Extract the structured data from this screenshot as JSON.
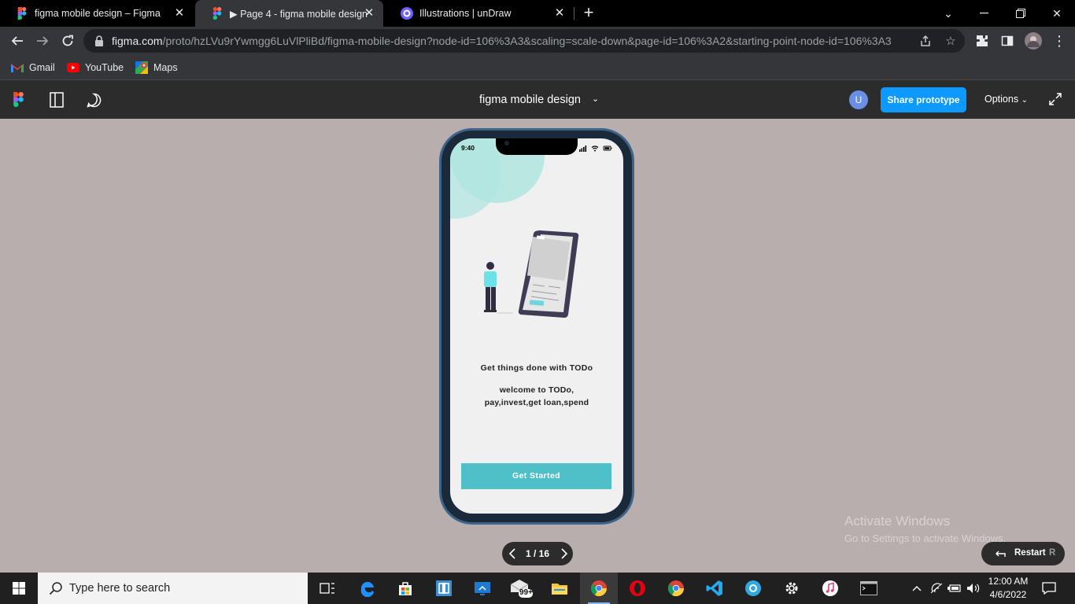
{
  "browser": {
    "tabs": [
      {
        "title": "figma mobile design – Figma",
        "icon": "figma-icon"
      },
      {
        "title": "▶ Page 4 - figma mobile design",
        "icon": "figma-icon"
      },
      {
        "title": "Illustrations | unDraw",
        "icon": "undraw-icon"
      }
    ],
    "url_host": "figma.com",
    "url_path": "/proto/hzLVu9rYwmgg6LuVlPliBd/figma-mobile-design?node-id=106%3A3&scaling=scale-down&page-id=106%3A2&starting-point-node-id=106%3A3",
    "bookmarks": [
      {
        "label": "Gmail",
        "icon": "gmail-icon"
      },
      {
        "label": "YouTube",
        "icon": "youtube-icon"
      },
      {
        "label": "Maps",
        "icon": "maps-icon"
      }
    ]
  },
  "figma": {
    "doc_title": "figma mobile design",
    "avatar_initial": "U",
    "share_label": "Share prototype",
    "options_label": "Options"
  },
  "screen": {
    "status_time": "9:40",
    "title": "Get things done with TODo",
    "subtitle_line1": "welcome to TODo,",
    "subtitle_line2": "pay,invest,get loan,spend",
    "button_label": "Get Started",
    "accent_color": "#4fc0c8"
  },
  "pager": {
    "label": "1 / 16"
  },
  "restart": {
    "label": "Restart",
    "shortcut": "R"
  },
  "watermark": {
    "line1": "Activate Windows",
    "line2": "Go to Settings to activate Windows."
  },
  "taskbar": {
    "search_placeholder": "Type here to search",
    "mail_badge": "99+",
    "time": "12:00 AM",
    "date": "4/6/2022"
  }
}
